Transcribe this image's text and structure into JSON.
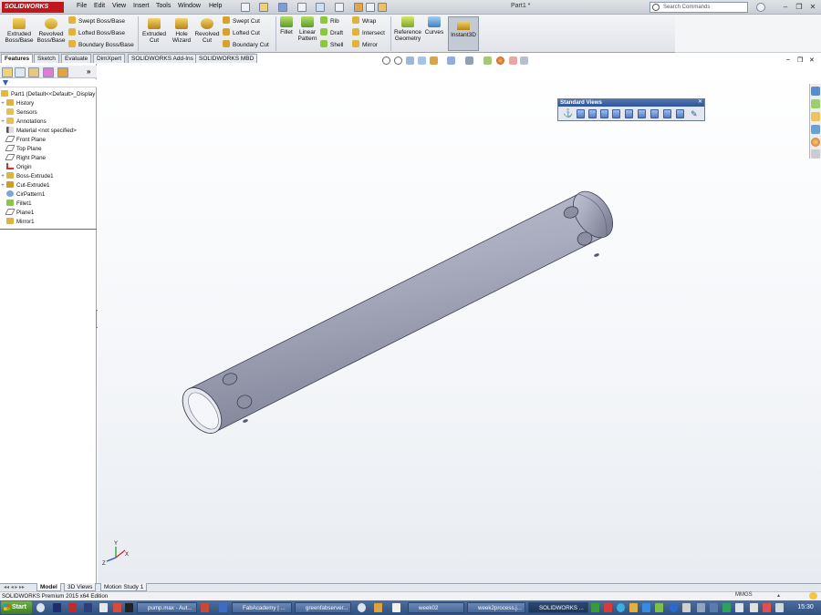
{
  "app": {
    "logo_text": "SOLIDWORKS",
    "document_title": "Part1 *"
  },
  "menu": [
    "File",
    "Edit",
    "View",
    "Insert",
    "Tools",
    "Window",
    "Help"
  ],
  "search": {
    "placeholder": "Search Commands"
  },
  "command_manager": {
    "extruded_boss": "Extruded Boss/Base",
    "revolved_boss": "Revolved Boss/Base",
    "swept_boss": "Swept Boss/Base",
    "lofted_boss": "Lofted Boss/Base",
    "boundary_boss": "Boundary Boss/Base",
    "extruded_cut": "Extruded Cut",
    "hole_wizard": "Hole Wizard",
    "revolved_cut": "Revolved Cut",
    "swept_cut": "Swept Cut",
    "lofted_cut": "Lofted Cut",
    "boundary_cut": "Boundary Cut",
    "fillet": "Fillet",
    "linear_pattern": "Linear Pattern",
    "rib": "Rib",
    "draft": "Draft",
    "shell": "Shell",
    "wrap": "Wrap",
    "intersect": "Intersect",
    "mirror": "Mirror",
    "reference_geometry": "Reference Geometry",
    "curves": "Curves",
    "instant3d": "Instant3D"
  },
  "tabs": [
    "Features",
    "Sketch",
    "Evaluate",
    "DimXpert",
    "SOLIDWORKS Add-Ins",
    "SOLIDWORKS MBD"
  ],
  "feature_tree": {
    "root": "Part1  (Default<<Default>_Display",
    "items": [
      {
        "label": "History",
        "expand": "+"
      },
      {
        "label": "Sensors",
        "expand": ""
      },
      {
        "label": "Annotations",
        "expand": "+"
      },
      {
        "label": "Material <not specified>",
        "expand": ""
      },
      {
        "label": "Front Plane",
        "expand": ""
      },
      {
        "label": "Top Plane",
        "expand": ""
      },
      {
        "label": "Right Plane",
        "expand": ""
      },
      {
        "label": "Origin",
        "expand": ""
      },
      {
        "label": "Boss-Extrude1",
        "expand": "+"
      },
      {
        "label": "Cut-Extrude1",
        "expand": "+"
      },
      {
        "label": "CirPattern1",
        "expand": ""
      },
      {
        "label": "Fillet1",
        "expand": ""
      },
      {
        "label": "Plane1",
        "expand": ""
      },
      {
        "label": "Mirror1",
        "expand": ""
      }
    ]
  },
  "standard_views": {
    "title": "Standard Views"
  },
  "triad": {
    "x": "X",
    "y": "Y",
    "z": "Z"
  },
  "bottom_tabs": [
    "Model",
    "3D Views",
    "Motion Study 1"
  ],
  "status": {
    "text": "SOLIDWORKS Premium 2015 x64 Edition",
    "units": "MMGS"
  },
  "taskbar": {
    "start": "Start",
    "tasks": [
      "pump.max - Aut...",
      "FabAcademy | ...",
      "greenfabserver...",
      "week02",
      "week2process.j...",
      "SOLIDWORKS ..."
    ],
    "clock": "15:30"
  },
  "colors": {
    "part_body": "#a7aabd",
    "accent": "#c0161c",
    "taskbar": "#3a5a8a"
  }
}
